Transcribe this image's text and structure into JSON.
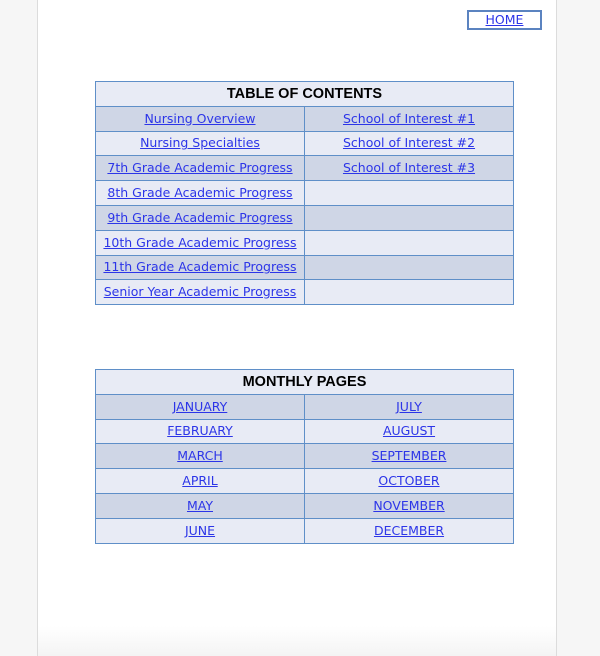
{
  "home_link": "HOME",
  "toc": {
    "title": "TABLE OF CONTENTS",
    "rows": [
      [
        "Nursing Overview",
        "School of Interest #1"
      ],
      [
        "Nursing Specialties",
        "School of Interest #2"
      ],
      [
        "7th Grade Academic Progress",
        "School of Interest #3"
      ],
      [
        "8th Grade Academic Progress",
        ""
      ],
      [
        "9th Grade Academic Progress",
        ""
      ],
      [
        "10th Grade Academic Progress",
        ""
      ],
      [
        "11th Grade Academic Progress",
        ""
      ],
      [
        "Senior Year Academic Progress",
        ""
      ]
    ]
  },
  "monthly": {
    "title": "MONTHLY PAGES",
    "rows": [
      [
        "JANUARY",
        "JULY"
      ],
      [
        "FEBRUARY",
        "AUGUST"
      ],
      [
        "MARCH",
        "SEPTEMBER"
      ],
      [
        "APRIL",
        "OCTOBER"
      ],
      [
        "MAY",
        "NOVEMBER"
      ],
      [
        "JUNE",
        "DECEMBER"
      ]
    ]
  },
  "colors": {
    "link": "#2c35e8",
    "border": "#5f8fc8",
    "row_light": "#e8ebf5",
    "row_dark": "#cfd6e6"
  }
}
